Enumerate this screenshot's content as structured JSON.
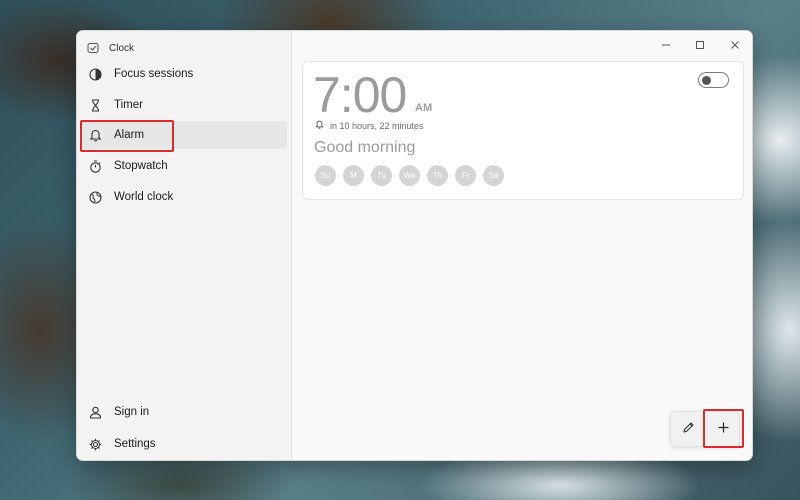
{
  "app": {
    "title": "Clock"
  },
  "sidebar": {
    "items": [
      {
        "id": "focus",
        "label": "Focus sessions",
        "icon": "focus-icon"
      },
      {
        "id": "timer",
        "label": "Timer",
        "icon": "hourglass-icon"
      },
      {
        "id": "alarm",
        "label": "Alarm",
        "icon": "bell-icon",
        "selected": true
      },
      {
        "id": "stopwatch",
        "label": "Stopwatch",
        "icon": "stopwatch-icon"
      },
      {
        "id": "worldclock",
        "label": "World clock",
        "icon": "globe-icon"
      }
    ],
    "footer": [
      {
        "id": "signin",
        "label": "Sign in",
        "icon": "person-icon"
      },
      {
        "id": "settings",
        "label": "Settings",
        "icon": "gear-icon"
      }
    ]
  },
  "alarm": {
    "time": "7:00",
    "ampm": "AM",
    "remaining": "in 10 hours, 22 minutes",
    "name": "Good morning",
    "enabled": false,
    "days": [
      "Su",
      "M",
      "Tu",
      "We",
      "Th",
      "Fr",
      "Sa"
    ]
  },
  "actions": {
    "edit_icon": "pencil-icon",
    "add_icon": "plus-icon"
  },
  "colors": {
    "highlight": "#d92b2b",
    "selected_nav": "#e6e6e6",
    "muted_text": "#9b9b9b",
    "day_chip": "#d4d4d4"
  }
}
